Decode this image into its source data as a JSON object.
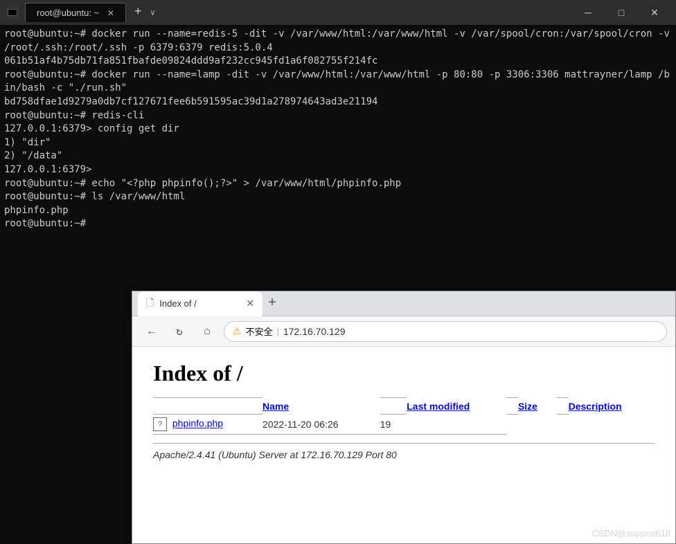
{
  "terminal": {
    "titlebar": {
      "icon": "terminal-icon",
      "title": "root@ubuntu: ~",
      "tab_label": "root@ubuntu: ~",
      "tab_close": "✕",
      "tab_add": "+",
      "tab_chevron": "∨",
      "btn_minimize": "─",
      "btn_maximize": "□",
      "btn_close": "✕"
    },
    "content": "root@ubuntu:~# docker run --name=redis-5 -dit -v /var/www/html:/var/www/html -v /var/spool/cron:/var/spool/cron -v /root/.ssh:/root/.ssh -p 6379:6379 redis:5.0.4\n061b51af4b75db71fa851fbafde09824ddd9af232cc945fd1a6f082755f214fc\nroot@ubuntu:~# docker run --name=lamp -dit -v /var/www/html:/var/www/html -p 80:80 -p 3306:3306 mattrayner/lamp /bin/bash -c \"./run.sh\"\nbd758dfae1d9279a0db7cf127671fee6b591595ac39d1a278974643ad3e21194\nroot@ubuntu:~# redis-cli\n127.0.0.1:6379> config get dir\n1) \"dir\"\n2) \"/data\"\n127.0.0.1:6379>\nroot@ubuntu:~# echo \"<?php phpinfo();?>\" > /var/www/html/phpinfo.php\nroot@ubuntu:~# ls /var/www/html\nphpinfo.php\nroot@ubuntu:~#"
  },
  "browser": {
    "titlebar": {
      "tab_icon": "🗋",
      "tab_label": "Index of /",
      "tab_close": "✕",
      "tab_new": "+"
    },
    "nav": {
      "back": "←",
      "refresh": "↻",
      "home": "⌂",
      "warning": "⚠",
      "warning_text": "不安全",
      "separator": "|",
      "url": "172.16.70.129"
    },
    "page": {
      "title": "Index of /",
      "table": {
        "columns": [
          "Name",
          "Last modified",
          "Size",
          "Description"
        ],
        "rows": [
          {
            "icon": "?",
            "name": "phpinfo.php",
            "modified": "2022-11-20 06:26",
            "size": "19",
            "description": ""
          }
        ]
      },
      "server_info": "Apache/2.4.41 (Ubuntu) Server at 172.16.70.129 Port 80"
    }
  },
  "watermark": "CSDN@suppos618"
}
